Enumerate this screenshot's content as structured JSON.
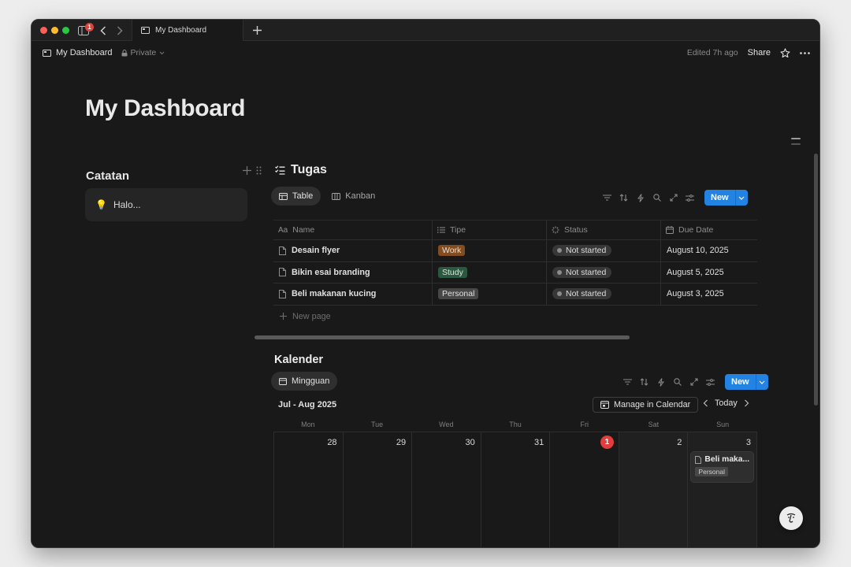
{
  "window": {
    "tab_title": "My Dashboard",
    "notification_count": "1"
  },
  "navbar": {
    "breadcrumb": "My Dashboard",
    "privacy": "Private",
    "edited": "Edited 7h ago",
    "share_label": "Share"
  },
  "page": {
    "title": "My Dashboard"
  },
  "catatan": {
    "title": "Catatan",
    "note": {
      "emoji": "💡",
      "text": "Halo..."
    }
  },
  "tugas": {
    "title": "Tugas",
    "views": [
      {
        "label": "Table",
        "active": true
      },
      {
        "label": "Kanban",
        "active": false
      }
    ],
    "new_label": "New",
    "columns": [
      "Name",
      "Tipe",
      "Status",
      "Due Date"
    ],
    "rows": [
      {
        "name": "Desain flyer",
        "tipe": "Work",
        "tipe_color": "#854c1d",
        "status": "Not started",
        "due": "August 10, 2025"
      },
      {
        "name": "Bikin esai branding",
        "tipe": "Study",
        "tipe_color": "#2b593f",
        "status": "Not started",
        "due": "August 5, 2025"
      },
      {
        "name": "Beli makanan kucing",
        "tipe": "Personal",
        "tipe_color": "#474747",
        "status": "Not started",
        "due": "August 3, 2025"
      }
    ],
    "new_page_label": "New page"
  },
  "kalender": {
    "title": "Kalender",
    "view_label": "Mingguan",
    "new_label": "New",
    "range_label": "Jul - Aug 2025",
    "manage_label": "Manage in Calendar",
    "today_label": "Today",
    "day_names": [
      "Mon",
      "Tue",
      "Wed",
      "Thu",
      "Fri",
      "Sat",
      "Sun"
    ],
    "days": [
      {
        "num": "28",
        "today": false,
        "weekend": false
      },
      {
        "num": "29",
        "today": false,
        "weekend": false
      },
      {
        "num": "30",
        "today": false,
        "weekend": false
      },
      {
        "num": "31",
        "today": false,
        "weekend": false
      },
      {
        "num": "1",
        "today": true,
        "weekend": false
      },
      {
        "num": "2",
        "today": false,
        "weekend": true
      },
      {
        "num": "3",
        "today": false,
        "weekend": true
      }
    ],
    "event": {
      "title": "Beli maka...",
      "tag": "Personal"
    }
  }
}
